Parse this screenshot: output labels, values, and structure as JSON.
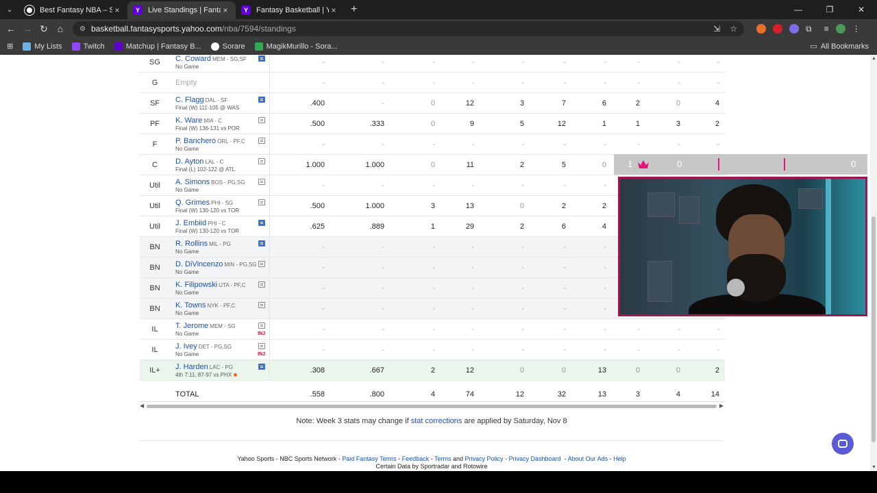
{
  "browser": {
    "tabs": [
      {
        "title": "Best Fantasy NBA – Sorare NBA",
        "active": false,
        "icon": "sorare-icon"
      },
      {
        "title": "Live Standings | Fantasy Basketb",
        "active": true,
        "icon": "yahoo-icon"
      },
      {
        "title": "Fantasy Basketball | Yahoo! Sp",
        "active": false,
        "icon": "yahoo-icon"
      }
    ],
    "url_domain": "basketball.fantasysports.yahoo.com",
    "url_path": "/nba/7594/standings",
    "bookmarks": [
      "My Lists",
      "Twitch",
      "Matchup | Fantasy B...",
      "Sorare",
      "MagikMurillo - Sora..."
    ],
    "all_bookmarks": "All Bookmarks"
  },
  "roster": [
    {
      "pos": "SG",
      "name": "C. Coward",
      "team": "MEM - SG,SF",
      "status": "No Game",
      "note": "blue",
      "stats": [
        "-",
        "-",
        "-",
        "-",
        "-",
        "-",
        "-",
        "-",
        "-",
        "-"
      ]
    },
    {
      "pos": "G",
      "name": "",
      "team": "",
      "status": "Empty",
      "note": "",
      "stats": [
        "-",
        "-",
        "-",
        "-",
        "-",
        "-",
        "-",
        "-",
        "-",
        "-"
      ]
    },
    {
      "pos": "SF",
      "name": "C. Flagg",
      "team": "DAL - SF",
      "status": "Final (W) 111-105 @ WAS",
      "note": "blue",
      "stats": [
        ".400",
        "-",
        "0",
        "12",
        "3",
        "7",
        "6",
        "2",
        "0",
        "4"
      ]
    },
    {
      "pos": "PF",
      "name": "K. Ware",
      "team": "MIA - C",
      "status": "Final (W) 136-131 vs POR",
      "note": "plain",
      "stats": [
        ".500",
        ".333",
        "0",
        "9",
        "5",
        "12",
        "1",
        "1",
        "3",
        "2"
      ]
    },
    {
      "pos": "F",
      "name": "P. Banchero",
      "team": "ORL - PF,C",
      "status": "No Game",
      "note": "plain",
      "stats": [
        "-",
        "-",
        "-",
        "-",
        "-",
        "-",
        "-",
        "-",
        "-",
        "-"
      ]
    },
    {
      "pos": "C",
      "name": "D. Ayton",
      "team": "LAL - C",
      "status": "Final (L) 102-122 @ ATL",
      "note": "plain",
      "stats": [
        "1.000",
        "1.000",
        "0",
        "11",
        "2",
        "5",
        "0",
        "",
        "",
        ""
      ]
    },
    {
      "pos": "Util",
      "name": "A. Simons",
      "team": "BOS - PG,SG",
      "status": "No Game",
      "note": "plain",
      "stats": [
        "-",
        "-",
        "-",
        "-",
        "-",
        "-",
        "-",
        "",
        "",
        ""
      ]
    },
    {
      "pos": "Util",
      "name": "Q. Grimes",
      "team": "PHI - SG",
      "status": "Final (W) 130-120 vs TOR",
      "note": "plain",
      "stats": [
        ".500",
        "1.000",
        "3",
        "13",
        "0",
        "2",
        "2",
        "",
        "",
        ""
      ]
    },
    {
      "pos": "Util",
      "name": "J. Embiid",
      "team": "PHI - C",
      "status": "Final (W) 130-120 vs TOR",
      "note": "blue",
      "stats": [
        ".625",
        ".889",
        "1",
        "29",
        "2",
        "6",
        "4",
        "",
        "",
        ""
      ]
    },
    {
      "pos": "BN",
      "name": "R. Rollins",
      "team": "MIL - PG",
      "status": "No Game",
      "note": "blue",
      "stats": [
        "-",
        "-",
        "-",
        "-",
        "-",
        "-",
        "-",
        "",
        "",
        ""
      ]
    },
    {
      "pos": "BN",
      "name": "D. DiVincenzo",
      "team": "MIN - PG,SG",
      "status": "No Game",
      "note": "plain",
      "stats": [
        "-",
        "-",
        "-",
        "-",
        "-",
        "-",
        "-",
        "",
        "",
        ""
      ]
    },
    {
      "pos": "BN",
      "name": "K. Filipowski",
      "team": "UTA - PF,C",
      "status": "No Game",
      "note": "plain",
      "stats": [
        "-",
        "-",
        "-",
        "-",
        "-",
        "-",
        "-",
        "",
        "",
        ""
      ]
    },
    {
      "pos": "BN",
      "name": "K. Towns",
      "team": "NYK - PF,C",
      "status": "No Game",
      "note": "plain",
      "stats": [
        "-",
        "-",
        "-",
        "-",
        "-",
        "-",
        "-",
        "",
        "",
        ""
      ]
    },
    {
      "pos": "IL",
      "name": "T. Jerome",
      "team": "MEM - SG",
      "status": "No Game",
      "note": "plain",
      "inj": "INJ",
      "stats": [
        "-",
        "-",
        "-",
        "-",
        "-",
        "-",
        "-",
        "-",
        "-",
        "-"
      ]
    },
    {
      "pos": "IL",
      "name": "J. Ivey",
      "team": "DET - PG,SG",
      "status": "No Game",
      "note": "plain",
      "inj": "INJ",
      "stats": [
        "-",
        "-",
        "-",
        "-",
        "-",
        "-",
        "-",
        "-",
        "-",
        "-"
      ]
    },
    {
      "pos": "IL+",
      "name": "J. Harden",
      "team": "LAC - PG",
      "status": "4th 7:11, 87-97  vs PHX",
      "note": "blue",
      "live": true,
      "stats": [
        ".308",
        ".667",
        "2",
        "12",
        "0",
        "0",
        "13",
        "0",
        "0",
        "2"
      ]
    }
  ],
  "total": {
    "label": "TOTAL",
    "stats": [
      ".558",
      ".800",
      "4",
      "74",
      "12",
      "32",
      "13",
      "3",
      "4",
      "14"
    ]
  },
  "overlay_scores": {
    "left": "1",
    "mid": "0",
    "right": "0"
  },
  "note": {
    "prefix": "Note: Week 3 stats may change if ",
    "link": "stat corrections",
    "suffix": " are applied by Saturday, Nov 8"
  },
  "footer": {
    "line1_prefix": "Yahoo Sports - NBC Sports Network - ",
    "links": [
      "Paid Fantasy Terms",
      "Feedback",
      "Terms",
      "Privacy Policy",
      "Privacy Dashboard",
      "About Our Ads",
      "Help"
    ],
    "line2": "Certain Data by Sportradar and Rotowire"
  }
}
